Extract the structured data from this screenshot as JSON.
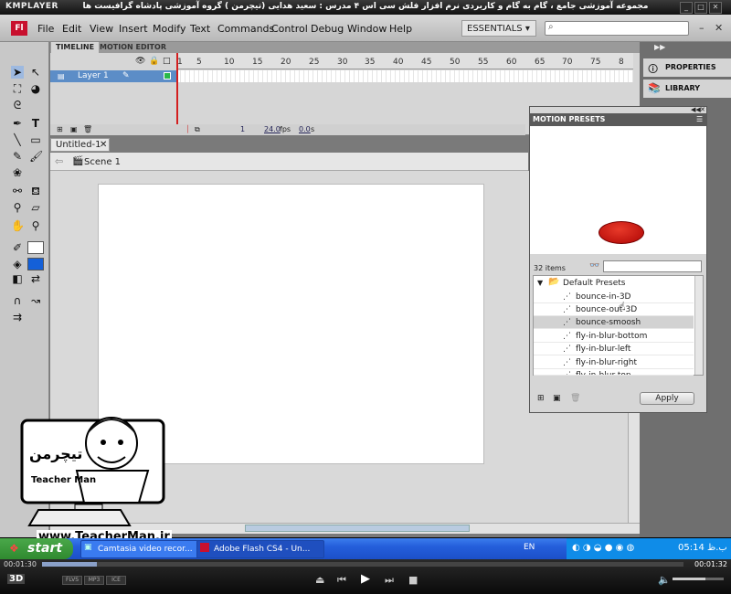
{
  "player": {
    "logo": "KMPLAYER",
    "title": "مجموعه آموزشی جامع ، گام به گام و کاربردی نرم افزار فلش سی اس ۴ مدرس : سعید هدایی (تیچرمن ) گروه آموزشی پادشاه گرافیست ها",
    "elapsed": "00:01:30",
    "total": "00:01:32",
    "badge_3d": "3D",
    "badges": [
      "FLVS",
      "MP3",
      "ICE"
    ],
    "seek_progress": 0.085
  },
  "flash": {
    "logo": "Fl",
    "menu": [
      "File",
      "Edit",
      "View",
      "Insert",
      "Modify",
      "Text",
      "Commands",
      "Control",
      "Debug",
      "Window",
      "Help"
    ],
    "workspace": "ESSENTIALS",
    "search_placeholder": "",
    "timeline_tabs": [
      "TIMELINE",
      "MOTION EDITOR"
    ],
    "layer_name": "Layer 1",
    "frame_numbers": [
      "1",
      "5",
      "10",
      "15",
      "20",
      "25",
      "30",
      "35",
      "40",
      "45",
      "50",
      "55",
      "60",
      "65",
      "70",
      "75",
      "8"
    ],
    "status": {
      "frame": "1",
      "fps": "24.0",
      "fps_unit": "fps",
      "time": "0.0",
      "time_unit": "s"
    },
    "doc_tab": "Untitled-1",
    "scene": "Scene 1",
    "dock": [
      "PROPERTIES",
      "LIBRARY"
    ]
  },
  "motion_presets": {
    "title": "MOTION PRESETS",
    "count": "32 items",
    "folder": "Default Presets",
    "items": [
      "bounce-in-3D",
      "bounce-out-3D",
      "bounce-smoosh",
      "fly-in-blur-bottom",
      "fly-in-blur-left",
      "fly-in-blur-right",
      "fly-in-blur-top"
    ],
    "selected_index": 2,
    "apply_label": "Apply",
    "ball_color": "#c0150f"
  },
  "watermark": {
    "url": "www.TeacherMan.ir",
    "caption": "Teacher Man"
  },
  "taskbar": {
    "start": "start",
    "tasks": [
      "Camtasia video recor...",
      "Adobe Flash CS4 - Un..."
    ],
    "lang": "EN",
    "clock": "05:14 ب.ظ"
  }
}
